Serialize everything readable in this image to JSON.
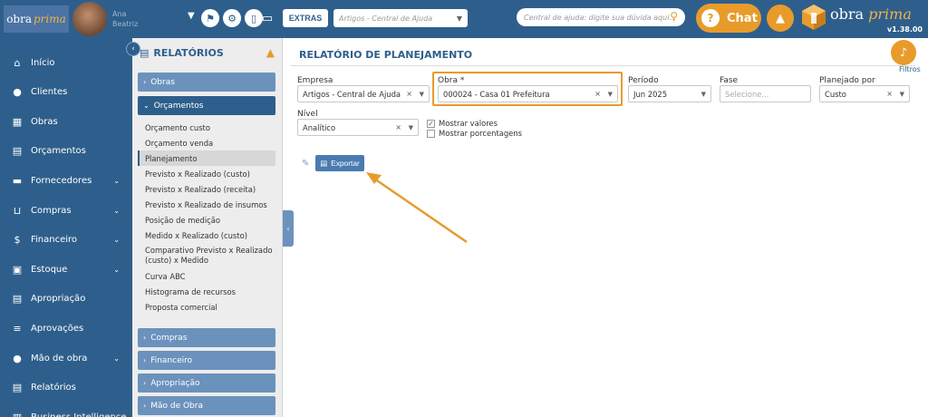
{
  "topbar": {
    "logo_main": "obra",
    "logo_accent": "prima",
    "username_line1": "Ana",
    "username_line2": "Beatriz",
    "extras_label": "EXTRAS",
    "help_select_placeholder": "Artigos - Central de Ajuda",
    "search_placeholder": "Central de ajuda: digite sua dúvida aqui...",
    "chat_label": "Chat",
    "brand_main": "obra",
    "brand_accent": "prima",
    "version": "v1.38.00",
    "icons": [
      "flag-icon",
      "gear-icon",
      "phone-icon",
      "monitor-icon"
    ]
  },
  "sidebar": {
    "items": [
      {
        "label": "Início",
        "icon": "⌂",
        "chev": false
      },
      {
        "label": "Clientes",
        "icon": "●",
        "chev": false
      },
      {
        "label": "Obras",
        "icon": "▦",
        "chev": false
      },
      {
        "label": "Orçamentos",
        "icon": "▤",
        "chev": false
      },
      {
        "label": "Fornecedores",
        "icon": "▬",
        "chev": true
      },
      {
        "label": "Compras",
        "icon": "⊔",
        "chev": true
      },
      {
        "label": "Financeiro",
        "icon": "$",
        "chev": true
      },
      {
        "label": "Estoque",
        "icon": "▣",
        "chev": true
      },
      {
        "label": "Apropriação",
        "icon": "▤",
        "chev": false
      },
      {
        "label": "Aprovações",
        "icon": "≡",
        "chev": false
      },
      {
        "label": "Mão de obra",
        "icon": "●",
        "chev": true
      },
      {
        "label": "Relatórios",
        "icon": "▤",
        "chev": false
      },
      {
        "label": "Business Intelligence",
        "icon": "▥",
        "chev": false
      }
    ]
  },
  "reports": {
    "title": "RELATÓRIOS",
    "categories_top": [
      "Obras",
      "Orçamentos"
    ],
    "items": [
      "Orçamento custo",
      "Orçamento venda",
      "Planejamento",
      "Previsto x Realizado (custo)",
      "Previsto x Realizado (receita)",
      "Previsto x Realizado de insumos",
      "Posição de medição",
      "Medido x Realizado (custo)",
      "Comparativo Previsto x Realizado (custo) x Medido",
      "Curva ABC",
      "Histograma de recursos",
      "Proposta comercial"
    ],
    "active_index": 2,
    "categories_bottom": [
      "Compras",
      "Financeiro",
      "Apropriação",
      "Mão de Obra"
    ]
  },
  "main": {
    "title": "RELATÓRIO DE PLANEJAMENTO",
    "filtros_label": "Filtros",
    "fields": {
      "empresa": {
        "label": "Empresa",
        "value": "Artigos - Central de Ajuda"
      },
      "obra": {
        "label": "Obra *",
        "value": "000024 - Casa 01 Prefeitura"
      },
      "periodo": {
        "label": "Período",
        "value": "Jun 2025"
      },
      "fase": {
        "label": "Fase",
        "placeholder": "Selecione..."
      },
      "planejado": {
        "label": "Planejado por",
        "value": "Custo"
      },
      "nivel": {
        "label": "Nível",
        "value": "Analítico"
      }
    },
    "checks": {
      "valores": {
        "label": "Mostrar valores",
        "checked": true
      },
      "porcentagens": {
        "label": "Mostrar porcentagens",
        "checked": false
      }
    },
    "export_label": "Exportar"
  },
  "colors": {
    "primary": "#2e5f8c",
    "accent": "#e89b2a",
    "category": "#6b92bd"
  }
}
